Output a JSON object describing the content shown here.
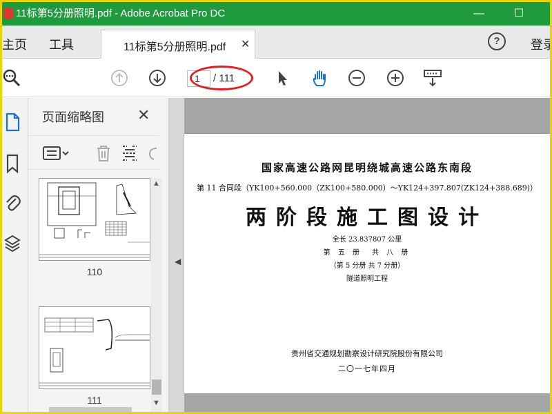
{
  "titlebar": {
    "title": "11标第5分册照明.pdf - Adobe Acrobat Pro DC",
    "minimize": "—",
    "maximize": "☐"
  },
  "tabs": {
    "home": "主页",
    "tools": "工具",
    "document": "11标第5分册照明.pdf",
    "close": "✕",
    "help": "?",
    "login": "登录"
  },
  "toolbar": {
    "current_page": "1",
    "total_pages": "/ 111"
  },
  "thumbnails_panel": {
    "title": "页面缩略图",
    "close": "✕",
    "thumbnails": [
      {
        "label": "110"
      },
      {
        "label": "111"
      }
    ]
  },
  "document": {
    "line1": "国家高速公路网昆明绕城高速公路东南段",
    "line2": "第 11 合同段（YK100+560.000（ZK100+580.000）～YK124+397.807(ZK124+388.689)）",
    "line3": "两阶段施工图设计",
    "line4": "全长 23.837807 公里",
    "line5": "第 五 册　共 八 册",
    "line6": "（第 5 分册 共 7 分册）",
    "line7": "隧道照明工程",
    "line8": "贵州省交通规划勘察设计研究院股份有限公司",
    "line9": "二〇一七年四月"
  },
  "colors": {
    "titlebar": "#1f9a3d",
    "frame": "#e6d500",
    "highlight": "#e02020",
    "icon_blue": "#1a73c9"
  }
}
